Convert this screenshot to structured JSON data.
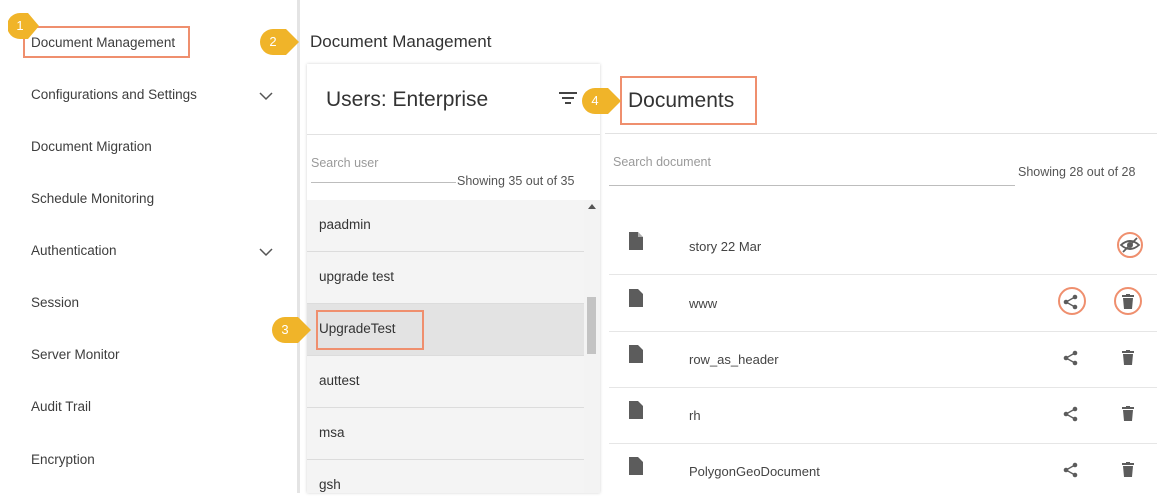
{
  "sidebar": {
    "items": [
      {
        "label": "Document Management",
        "has_chevron": false
      },
      {
        "label": "Configurations and Settings",
        "has_chevron": true
      },
      {
        "label": "Document Migration",
        "has_chevron": false
      },
      {
        "label": "Schedule Monitoring",
        "has_chevron": false
      },
      {
        "label": "Authentication",
        "has_chevron": true
      },
      {
        "label": "Session",
        "has_chevron": false
      },
      {
        "label": "Server Monitor",
        "has_chevron": false
      },
      {
        "label": "Audit Trail",
        "has_chevron": false
      },
      {
        "label": "Encryption",
        "has_chevron": false
      }
    ]
  },
  "callouts": {
    "c1": "1",
    "c2": "2",
    "c3": "3",
    "c4": "4"
  },
  "main": {
    "page_title": "Document Management"
  },
  "users": {
    "title": "Users: Enterprise",
    "search_placeholder": "Search user",
    "showing": "Showing 35 out of 35",
    "rows": [
      "paadmin",
      "upgrade test",
      "UpgradeTest",
      "auttest",
      "msa",
      "gsh"
    ],
    "selected": "UpgradeTest"
  },
  "documents": {
    "title": "Documents",
    "search_placeholder": "Search document",
    "showing": "Showing 28 out of 28",
    "rows": [
      "story 22 Mar",
      "www",
      "row_as_header",
      "rh",
      "PolygonGeoDocument"
    ]
  },
  "colors": {
    "accent": "#f0b429",
    "highlight": "#ef8f6e",
    "icon": "#5c5c5c"
  }
}
